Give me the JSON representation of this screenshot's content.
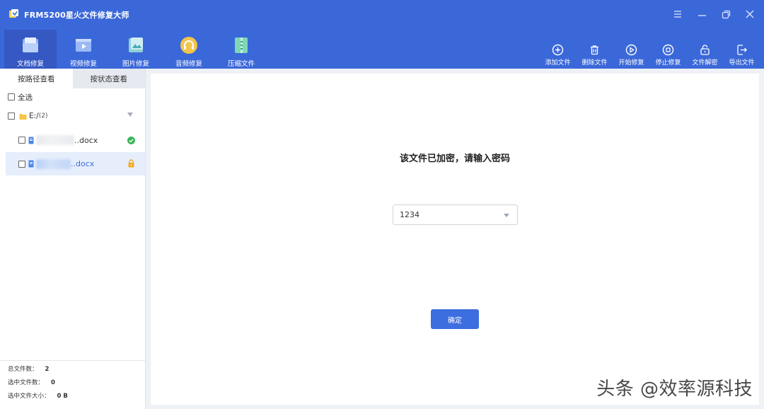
{
  "app": {
    "title": "FRM5200星火文件修复大师"
  },
  "nav_tabs": [
    {
      "label": "文档修复",
      "icon": "document-folder-icon",
      "active": true
    },
    {
      "label": "视频修复",
      "icon": "video-icon",
      "active": false
    },
    {
      "label": "图片修复",
      "icon": "image-icon",
      "active": false
    },
    {
      "label": "音频修复",
      "icon": "headphones-icon",
      "active": false
    },
    {
      "label": "压缩文件",
      "icon": "archive-icon",
      "active": false
    }
  ],
  "actions": [
    {
      "label": "添加文件",
      "icon": "plus-circle-icon"
    },
    {
      "label": "删除文件",
      "icon": "trash-icon"
    },
    {
      "label": "开始修复",
      "icon": "play-circle-icon"
    },
    {
      "label": "停止修复",
      "icon": "stop-circle-icon"
    },
    {
      "label": "文件解密",
      "icon": "unlock-icon"
    },
    {
      "label": "导出文件",
      "icon": "export-icon"
    }
  ],
  "sidebar": {
    "view_tabs": [
      {
        "label": "按路径查看",
        "active": true
      },
      {
        "label": "按状态查看",
        "active": false
      }
    ],
    "select_all": "全选",
    "folder": {
      "name": "E:/",
      "count": "(2)"
    },
    "files": [
      {
        "suffix": "..docx",
        "status": "success",
        "status_icon": "check-circle-icon"
      },
      {
        "suffix": "..docx",
        "status": "locked",
        "status_icon": "lock-icon"
      }
    ],
    "stats": {
      "total_label": "总文件数：",
      "total_value": "2",
      "selected_label": "选中文件数：",
      "selected_value": "0",
      "size_label": "选中文件大小：",
      "size_value": "0 B"
    }
  },
  "main": {
    "prompt": "该文件已加密，请输入密码",
    "password_value": "1234",
    "confirm_label": "确定"
  },
  "watermark": "头条 @效率源科技",
  "colors": {
    "brand": "#3b68d9",
    "button": "#3d6ee0",
    "success": "#3cb55a",
    "locked": "#f3a922"
  }
}
